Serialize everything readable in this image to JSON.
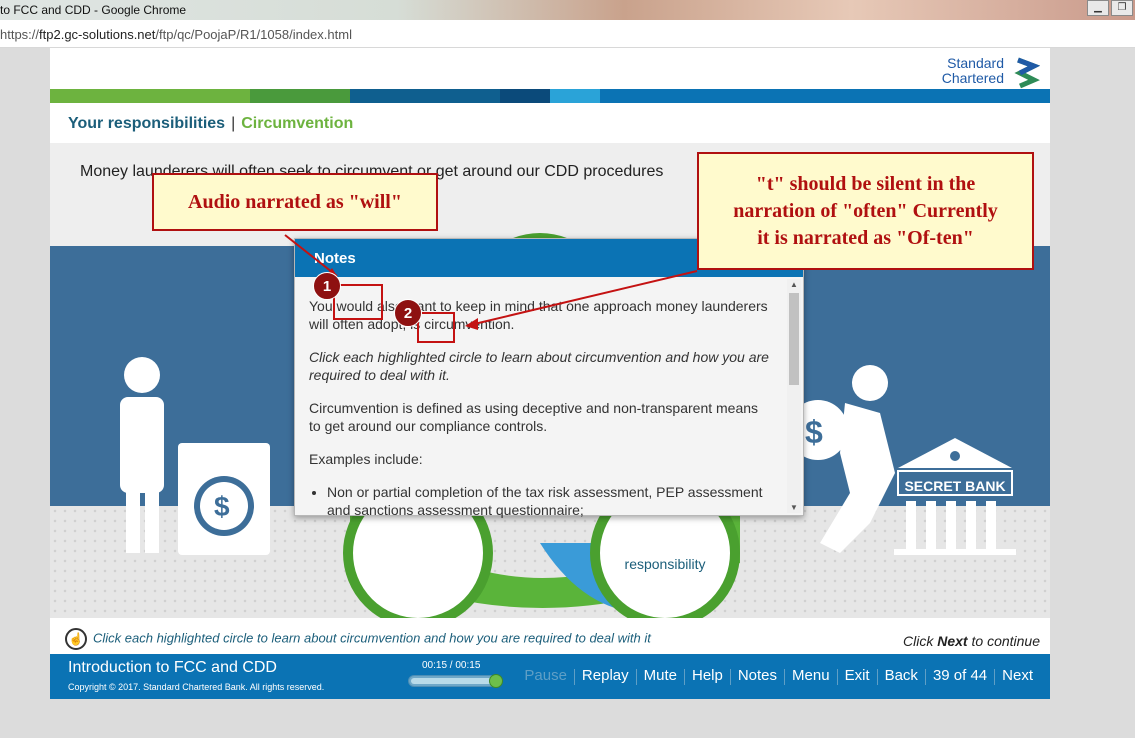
{
  "window": {
    "title": "to FCC and CDD - Google Chrome",
    "min_icon": "minimize-icon",
    "restore_icon": "restore-icon"
  },
  "address": {
    "scheme": "https://",
    "host": "ftp2.gc-solutions.net",
    "path": "/ftp/qc/PoojaP/R1/1058/index.html"
  },
  "logo": {
    "line1": "Standard",
    "line2": "Chartered",
    "color": "#1f5aa6"
  },
  "breadcrumb": {
    "section": "Your responsibilities",
    "separator": "|",
    "topic": "Circumvention"
  },
  "stage": {
    "heading": "Money launderers will often seek to circumvent or get around our CDD procedures",
    "bank_sign": "SECRET BANK",
    "circle_label": "responsibility"
  },
  "notes": {
    "title": "Notes",
    "p1": "You would also want to keep in mind that one approach money launderers will often adopt, is circumvention.",
    "p2": "Click each highlighted circle to learn about circumvention and how you are required to deal with it.",
    "p3": "Circumvention is defined as using deceptive and non-transparent means to get around our compliance controls.",
    "p4": "Examples include:",
    "bullet1": "Non or partial completion of the tax risk assessment, PEP assessment and sanctions assessment questionnaire;"
  },
  "annotations": {
    "callout1": "Audio narrated as \"will\"",
    "callout2_line1": "\"t\" should be silent in the",
    "callout2_line2": "narration of \"often\" Currently",
    "callout2_line3": "it is narrated as \"Of-ten\"",
    "marker1": "1",
    "marker2": "2",
    "color": "#b01010"
  },
  "hint": {
    "text": "Click each highlighted circle to learn about circumvention and how you are required to deal with it"
  },
  "continue": {
    "prefix": "Click ",
    "bold": "Next",
    "suffix": " to continue"
  },
  "footer": {
    "title": "Introduction to FCC and CDD",
    "copyright": "Copyright © 2017. Standard Chartered Bank. All rights reserved.",
    "time": "00:15 / 00:15",
    "progress": 1.0,
    "buttons": {
      "pause": "Pause",
      "replay": "Replay",
      "mute": "Mute",
      "help": "Help",
      "notes": "Notes",
      "menu": "Menu",
      "exit": "Exit",
      "back": "Back",
      "page": "39 of 44",
      "next": "Next"
    }
  },
  "colors": {
    "brand_blue": "#0b73b4",
    "brand_green": "#6db33f",
    "band": [
      "#6db33f",
      "#4a9a3c",
      "#0f5f8f",
      "#0b4a7a",
      "#2aa3d8",
      "#0b73b4"
    ]
  }
}
